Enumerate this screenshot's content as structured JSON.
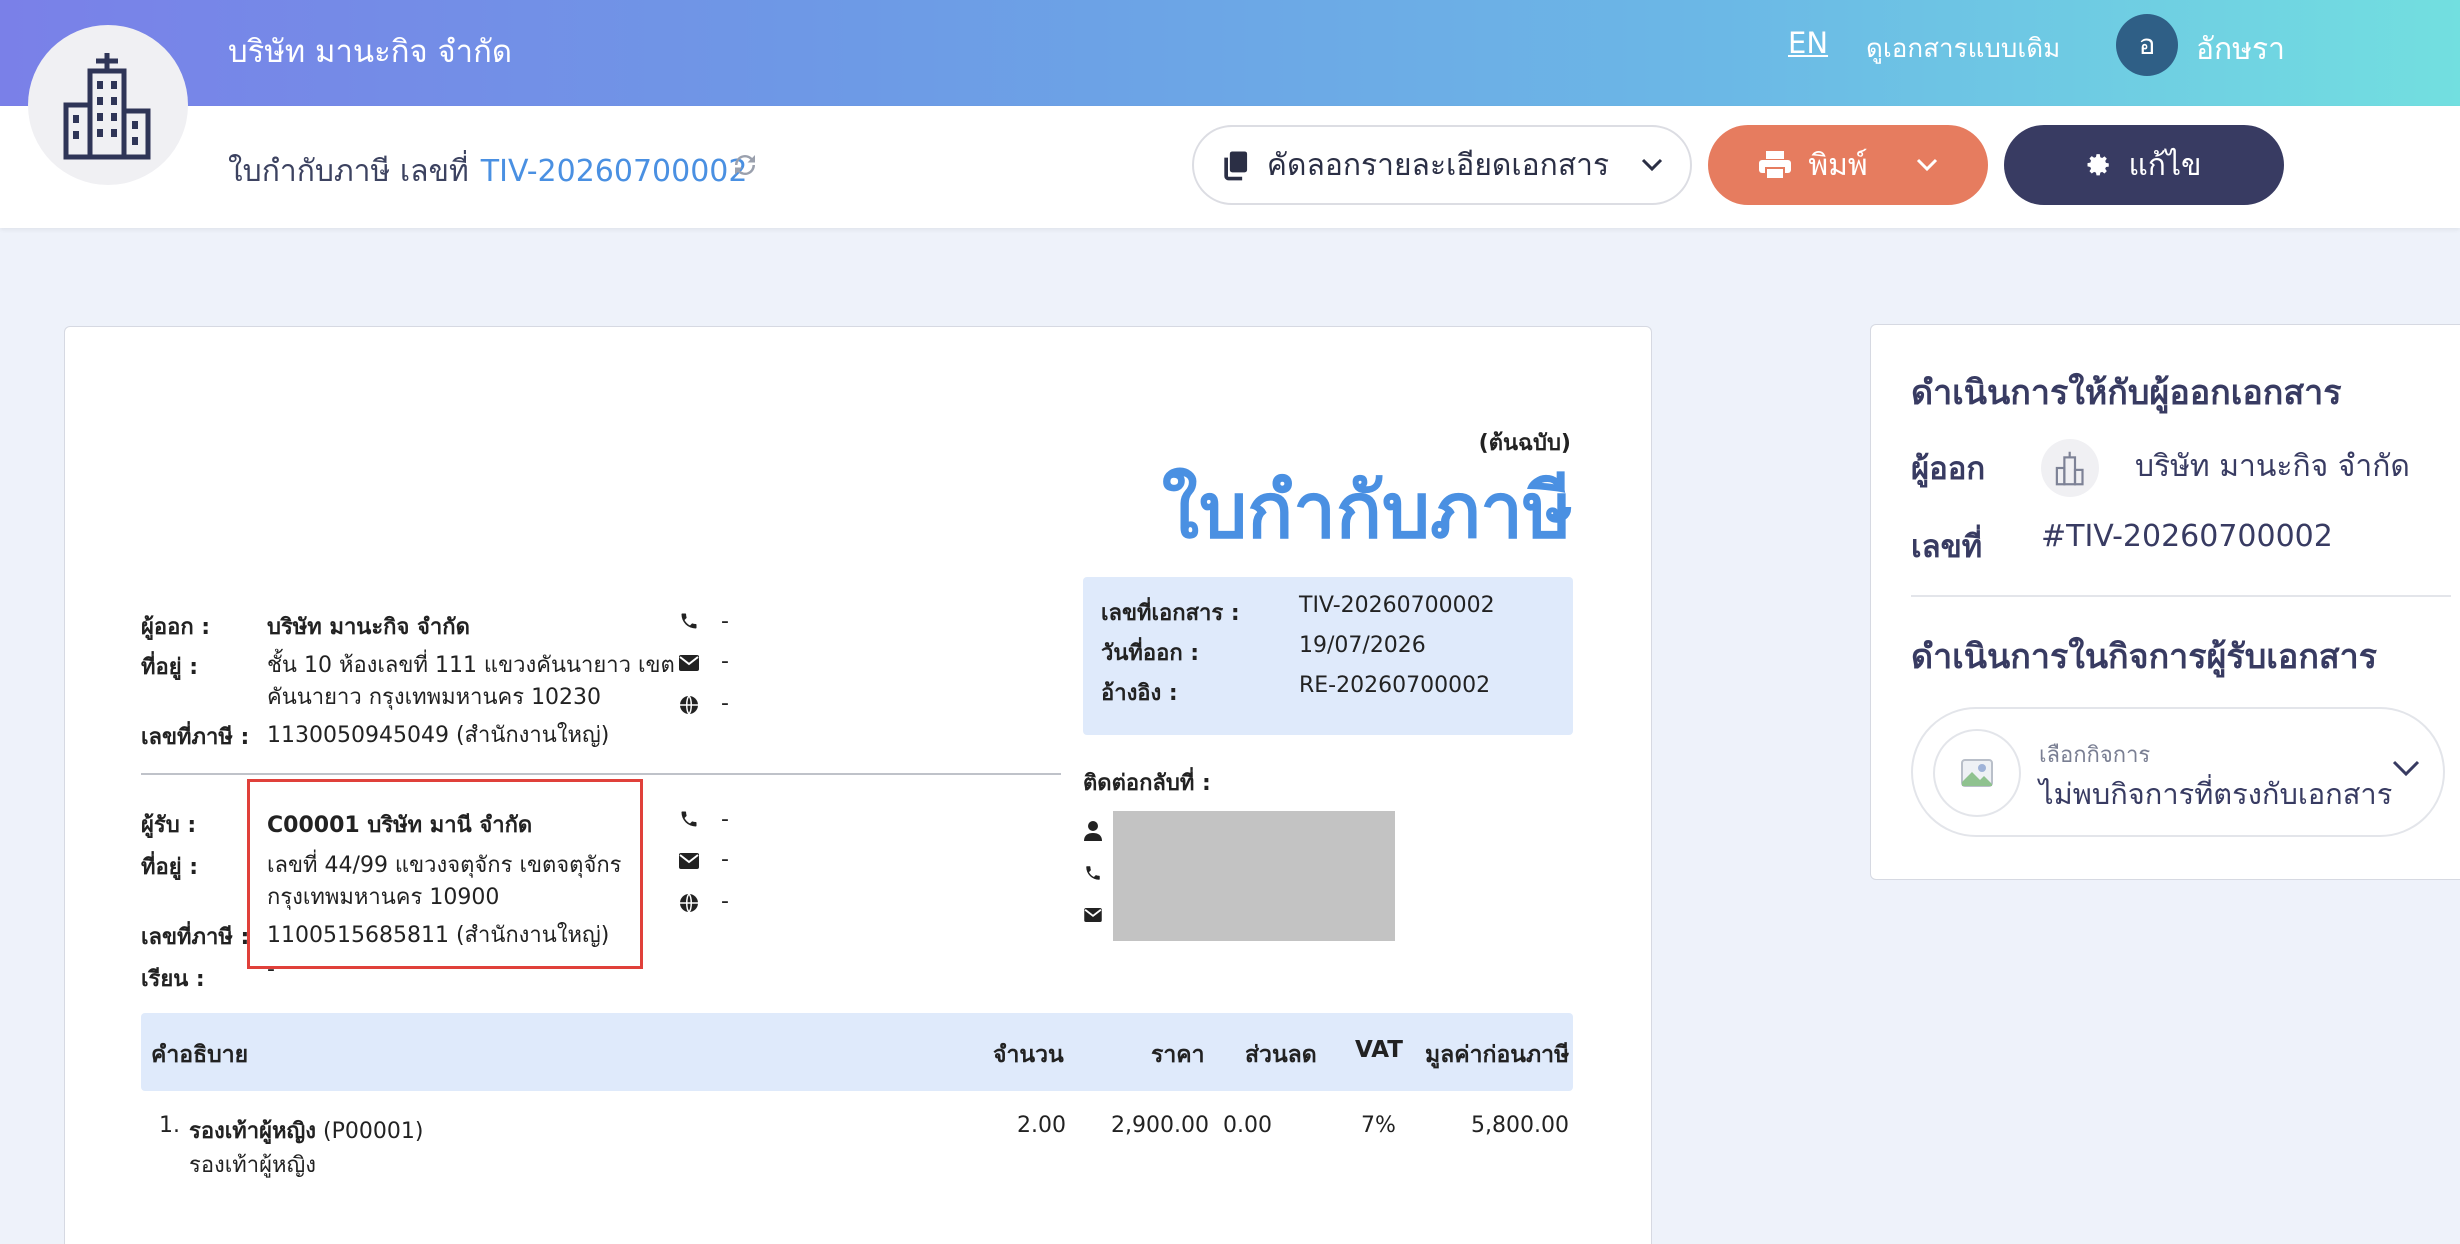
{
  "header": {
    "company_name": "บริษัท มานะกิจ จำกัด",
    "lang": "EN",
    "old_doc_link": "ดูเอกสารแบบเดิม",
    "user_initial": "อ",
    "user_name": "อักษรา"
  },
  "subheader": {
    "doc_type_label": "ใบกำกับภาษี เลขที่",
    "doc_number": "TIV-20260700002",
    "copy_button": "คัดลอกรายละเอียดเอกสาร",
    "print_button": "พิมพ์",
    "edit_button": "แก้ไข"
  },
  "document": {
    "original_label": "(ต้นฉบับ)",
    "title": "ใบกำกับภาษี",
    "issuer": {
      "label_issuer": "ผู้ออก :",
      "name": "บริษัท มานะกิจ จำกัด",
      "label_address": "ที่อยู่ :",
      "address_line1": "ชั้น 10 ห้องเลขที่ 111 แขวงคันนายาว เขต",
      "address_line2": "คันนายาว กรุงเทพมหานคร 10230",
      "label_tax": "เลขที่ภาษี :",
      "tax_id": "1130050945049 (สำนักงานใหญ่)",
      "phone": "-",
      "email": "-",
      "web": "-"
    },
    "info": {
      "label_docno": "เลขที่เอกสาร :",
      "docno": "TIV-20260700002",
      "label_date": "วันที่ออก :",
      "date": "19/07/2026",
      "label_ref": "อ้างอิง :",
      "ref": "RE-20260700002"
    },
    "recipient": {
      "label_recipient": "ผู้รับ :",
      "name": "C00001 บริษัท มานี จำกัด",
      "label_address": "ที่อยู่ :",
      "address_line1": "เลขที่ 44/99  แขวงจตุจักร เขตจตุจักร",
      "address_line2": "กรุงเทพมหานคร 10900",
      "label_tax": "เลขที่ภาษี :",
      "tax_id": "1100515685811 (สำนักงานใหญ่)",
      "label_attn": "เรียน :",
      "attn": "-",
      "phone": "-",
      "email": "-",
      "web": "-"
    },
    "contact_back_label": "ติดต่อกลับที่ :",
    "table": {
      "headers": [
        "คำอธิบาย",
        "จำนวน",
        "ราคา",
        "ส่วนลด",
        "VAT",
        "มูลค่าก่อนภาษี"
      ],
      "rows": [
        {
          "index": "1.",
          "name": "รองเท้าผู้หญิง",
          "code": "(P00001)",
          "desc": "รองเท้าผู้หญิง",
          "qty": "2.00",
          "price": "2,900.00",
          "discount": "0.00",
          "vat": "7%",
          "amount": "5,800.00"
        }
      ]
    }
  },
  "side_panel": {
    "issuer_section_title": "ดำเนินการให้กับผู้ออกเอกสาร",
    "label_issuer": "ผู้ออก",
    "issuer_name": "บริษัท มานะกิจ จำกัด",
    "label_number": "เลขที่",
    "number": "#TIV-20260700002",
    "receiver_section_title": "ดำเนินการในกิจการผู้รับเอกสาร",
    "select_hint": "เลือกกิจการ",
    "select_value": "ไม่พบกิจการที่ตรงกับเอกสาร"
  },
  "colors": {
    "accent_blue": "#4a90e2",
    "print_orange": "#e67c5f",
    "edit_navy": "#383b62",
    "highlight_red": "#e0403a"
  }
}
